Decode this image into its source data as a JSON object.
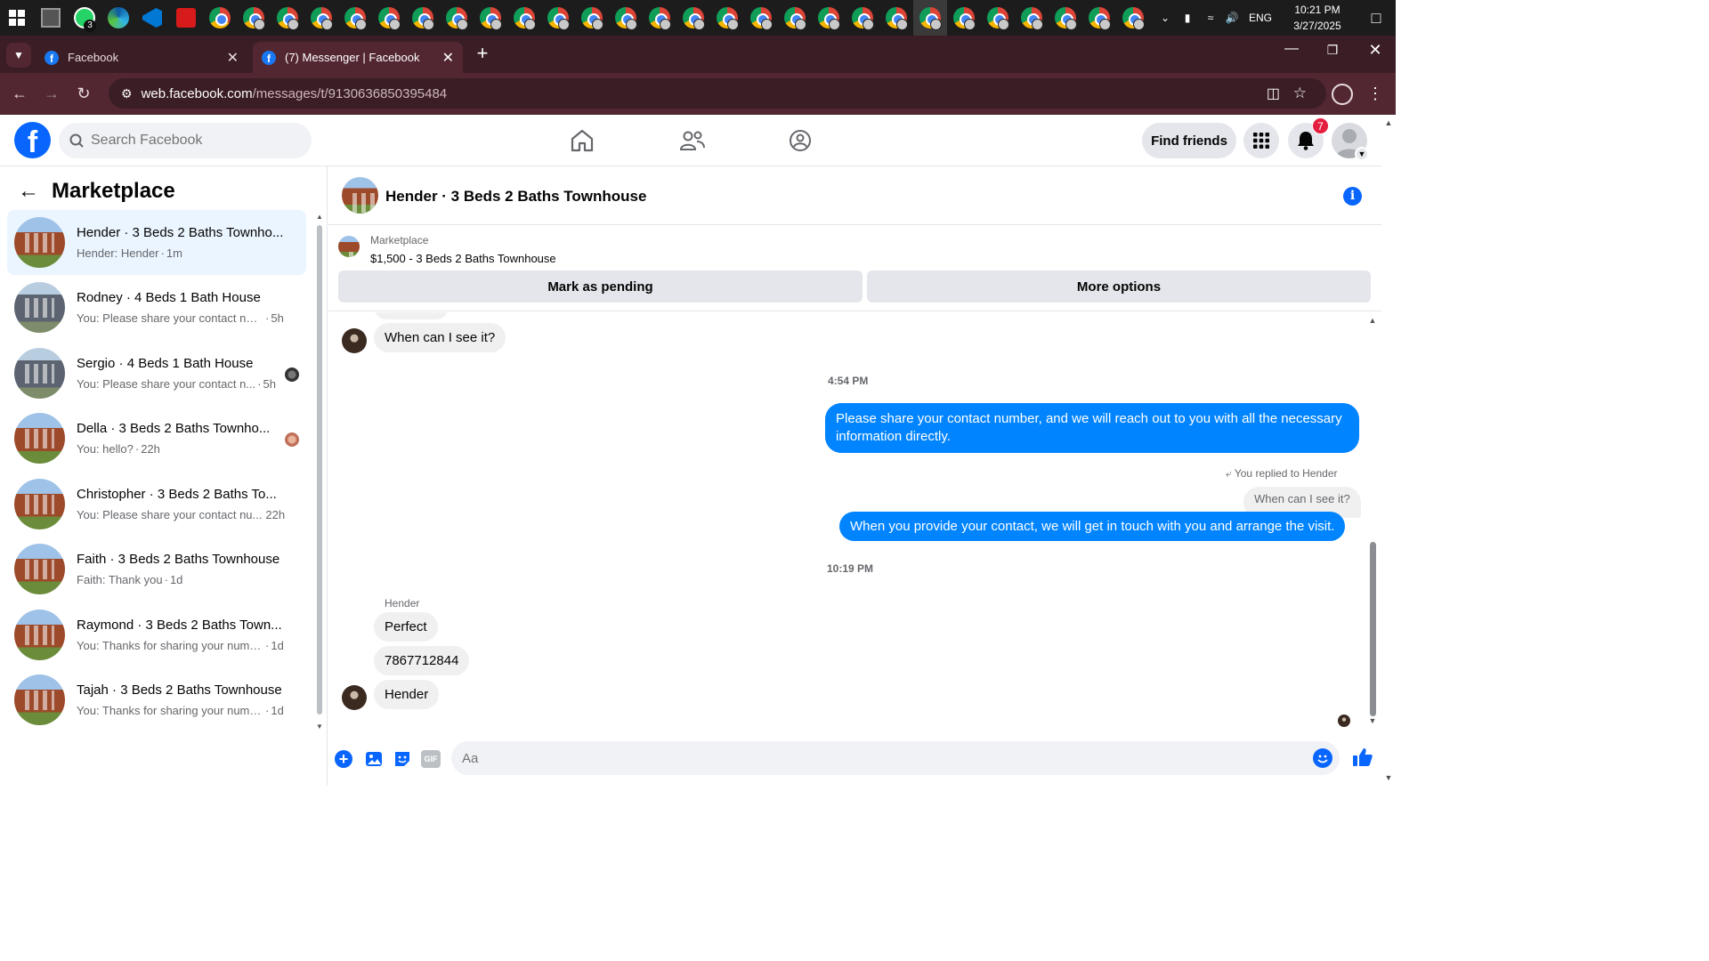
{
  "taskbar": {
    "whatsapp_badge": "3",
    "tray_lang": "ENG",
    "clock_time": "10:21 PM",
    "clock_date": "3/27/2025"
  },
  "browser": {
    "tabs": [
      {
        "label": "Facebook"
      },
      {
        "label": "(7) Messenger | Facebook"
      }
    ],
    "url_host": "web.facebook.com",
    "url_path": "/messages/t/9130636850395484"
  },
  "fb_header": {
    "search_placeholder": "Search Facebook",
    "find_friends": "Find friends",
    "notification_count": "7"
  },
  "left_panel": {
    "title": "Marketplace",
    "conversations": [
      {
        "title": "Hender · 3 Beds 2 Baths Townho...",
        "msg": "Hender: Hender",
        "time": "1m",
        "thumb": "brick"
      },
      {
        "title": "Rodney · 4 Beds 1 Bath House",
        "msg": "You: Please share your contact num...",
        "time": "5h",
        "thumb": "gray"
      },
      {
        "title": "Sergio · 4 Beds 1 Bath House",
        "msg": "You: Please share your contact n...",
        "time": "5h",
        "thumb": "gray"
      },
      {
        "title": "Della · 3 Beds 2 Baths Townho...",
        "msg": "You: hello?",
        "time": "22h",
        "thumb": "brick"
      },
      {
        "title": "Christopher · 3 Beds 2 Baths To...",
        "msg": "You: Please share your contact nu...",
        "time": "22h",
        "thumb": "brick"
      },
      {
        "title": "Faith · 3 Beds 2 Baths Townhouse",
        "msg": "Faith: Thank you",
        "time": "1d",
        "thumb": "brick"
      },
      {
        "title": "Raymond · 3 Beds 2 Baths Town...",
        "msg": "You: Thanks for sharing your numb...",
        "time": "1d",
        "thumb": "brick"
      },
      {
        "title": "Tajah · 3 Beds 2 Baths Townhouse",
        "msg": "You: Thanks for sharing your numb...",
        "time": "1d",
        "thumb": "brick"
      }
    ]
  },
  "chat": {
    "title": "Hender · 3 Beds 2 Baths Townhouse",
    "listing_label": "Marketplace",
    "listing_price_title": "$1,500 - 3 Beds 2 Baths Townhouse",
    "mark_pending": "Mark as pending",
    "more_options": "More options",
    "messages": {
      "in1": "When can I see it?",
      "ts1": "4:54 PM",
      "out1": "Please share your contact number, and we will reach out to you with all the necessary information directly.",
      "reply_label": "You replied to Hender",
      "quoted": "When can I see it?",
      "out2": "When you provide your contact, we will get in touch with you and arrange the visit.",
      "ts2": "10:19 PM",
      "sender": "Hender",
      "in2": "Perfect",
      "in3": "7867712844",
      "in4": "Hender"
    },
    "composer_placeholder": "Aa"
  },
  "colors": {
    "fb_blue": "#0866ff",
    "bubble_out": "#0084ff",
    "browser_frame": "#532732"
  }
}
